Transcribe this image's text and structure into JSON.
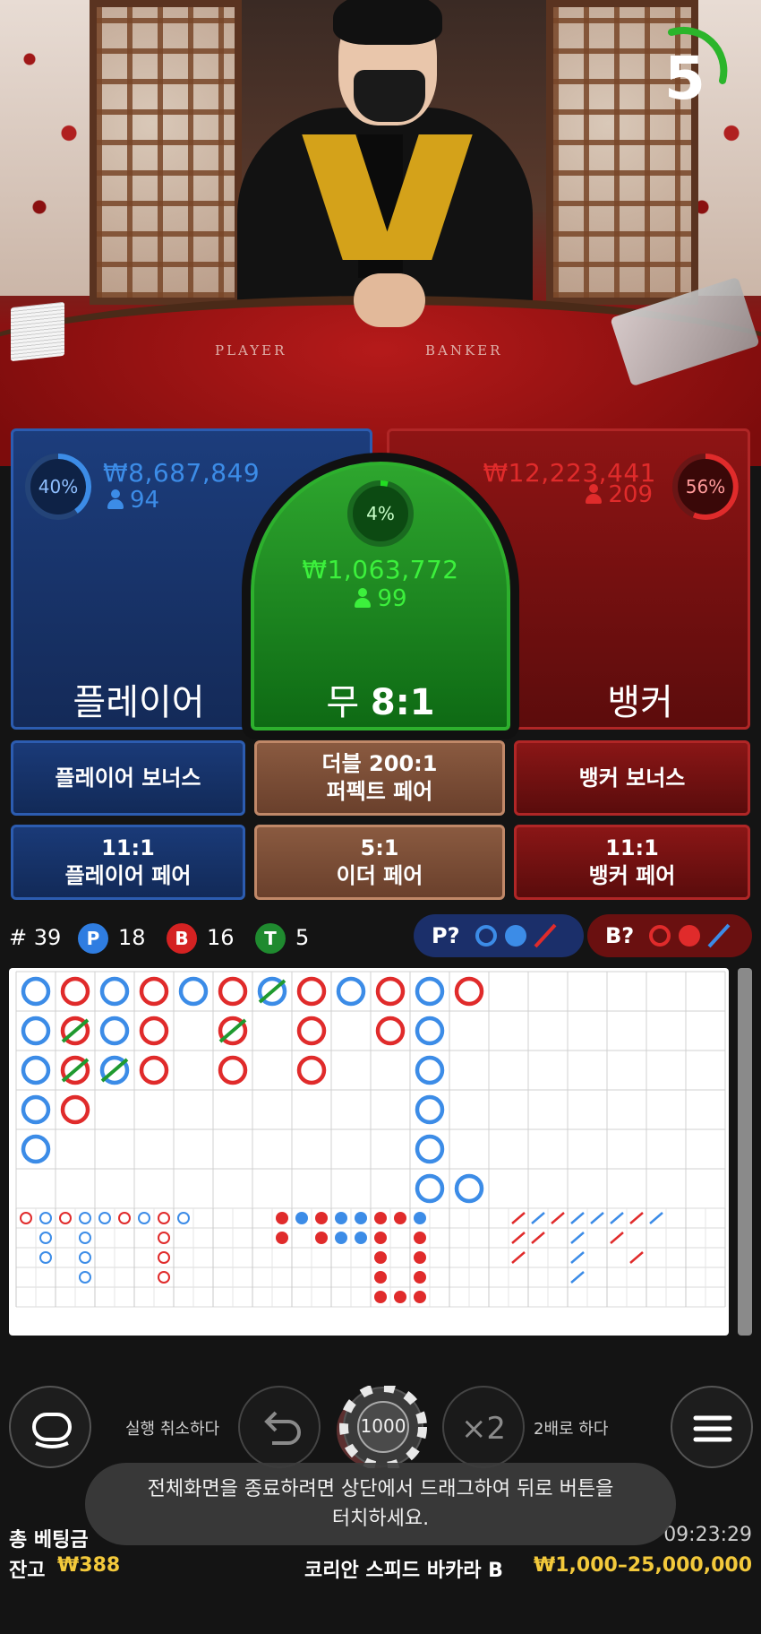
{
  "timer": {
    "value": "5",
    "color": "#2bb52b"
  },
  "video": {
    "felt_left": "PLAYER",
    "felt_right": "BANKER"
  },
  "player": {
    "percent": "40%",
    "amount": "₩8,687,849",
    "count": "94",
    "label": "플레이어",
    "color": "#3c8ce7"
  },
  "banker": {
    "percent": "56%",
    "amount": "₩12,223,441",
    "count": "209",
    "label": "뱅커",
    "color": "#e02b2b"
  },
  "tie": {
    "percent": "4%",
    "amount": "₩1,063,772",
    "count": "99",
    "label": "무",
    "payout": "8:1",
    "color": "#22dd22"
  },
  "side_bets": {
    "player_bonus": "플레이어 보너스",
    "perfect_pair_top": "더블 200:1",
    "perfect_pair_bottom": "퍼펙트 페어",
    "banker_bonus": "뱅커 보너스",
    "player_pair_top": "11:1",
    "player_pair_bottom": "플레이어 페어",
    "either_pair_top": "5:1",
    "either_pair_bottom": "이더 페어",
    "banker_pair_top": "11:1",
    "banker_pair_bottom": "뱅커 페어"
  },
  "stats": {
    "rounds": "# 39",
    "p_letter": "P",
    "p_count": "18",
    "b_letter": "B",
    "b_count": "16",
    "t_letter": "T",
    "t_count": "5",
    "predict_p": "P?",
    "predict_b": "B?"
  },
  "controls": {
    "undo_label": "실행 취소하다",
    "chip_value": "1000",
    "double_symbol": "×2",
    "double_label": "2배로 하다"
  },
  "toast": {
    "line1": "전체화면을 종료하려면 상단에서 드래그하여 뒤로 버튼을",
    "line2": "터치하세요."
  },
  "footer": {
    "total_bet_label": "총 베팅금",
    "time": "09:23:29",
    "balance_label": "잔고",
    "balance_value": "₩388",
    "table_name": "코리안 스피드 바카라 B",
    "limits": "₩1,000–25,000,000"
  }
}
